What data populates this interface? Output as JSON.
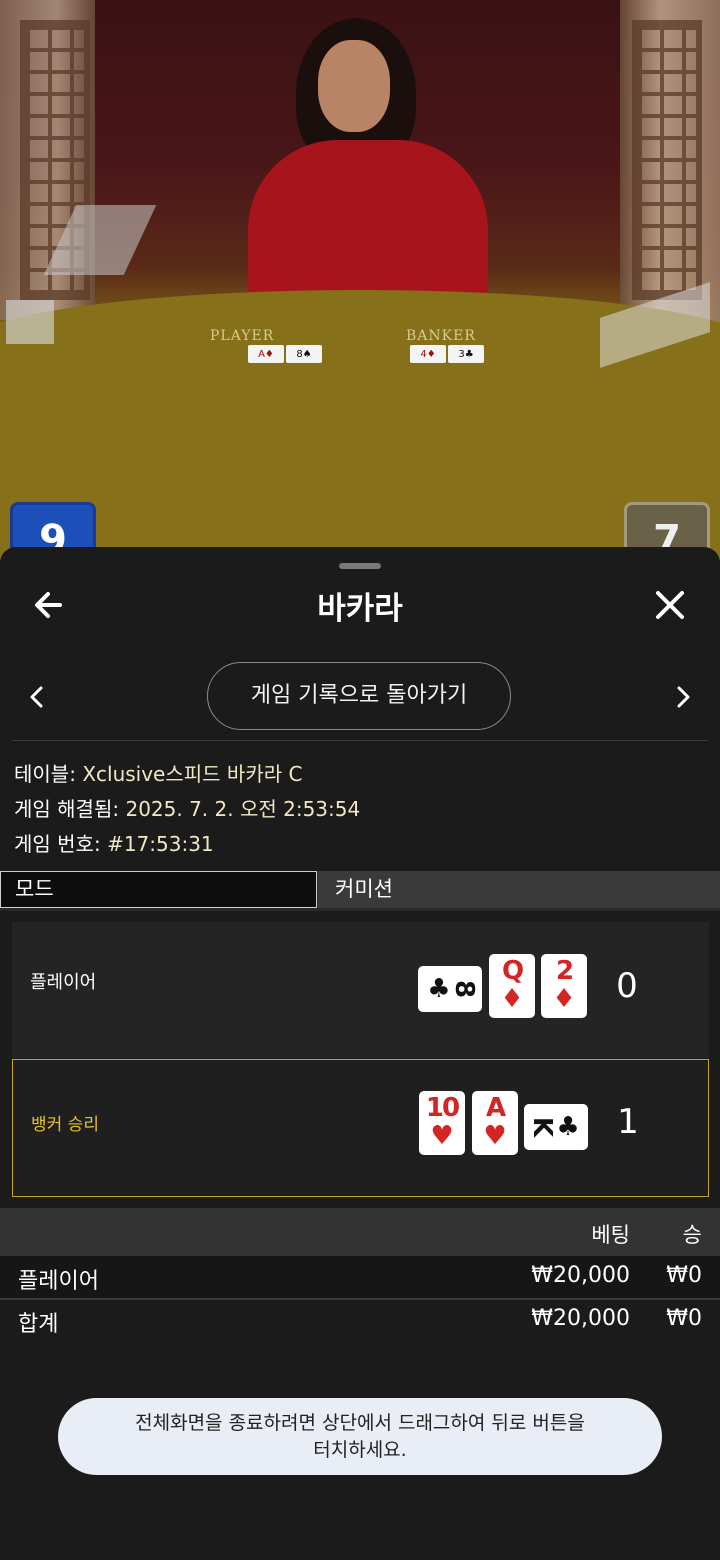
{
  "video": {
    "table_labels": {
      "player": "PLAYER",
      "banker": "BANKER"
    },
    "player_score": "9",
    "banker_score": "7"
  },
  "header": {
    "back_icon": "arrow-left-icon",
    "title": "바카라",
    "close_icon": "close-icon"
  },
  "nav": {
    "prev_icon": "chevron-left-icon",
    "next_icon": "chevron-right-icon",
    "back_to_history_label": "게임 기록으로 돌아가기"
  },
  "info": {
    "table_label": "테이블:",
    "table_value": "Xclusive스피드 바카라 C",
    "resolved_label": "게임 해결됨:",
    "resolved_value": "2025. 7. 2. 오전 2:53:54",
    "number_label": "게임 번호:",
    "number_value": "#17:53:31"
  },
  "tabs": {
    "mode": "모드",
    "commission": "커미션"
  },
  "results": {
    "player": {
      "label": "플레이어",
      "score": "0",
      "cards": [
        {
          "rank": "8",
          "suit": "♣",
          "color": "#111111",
          "orientation": "sideways"
        },
        {
          "rank": "Q",
          "suit": "♦",
          "color": "#d42424",
          "orientation": "upright"
        },
        {
          "rank": "2",
          "suit": "♦",
          "color": "#d42424",
          "orientation": "upright"
        }
      ]
    },
    "banker": {
      "label": "뱅커 승리",
      "label_color": "#e6c02a",
      "score": "1",
      "cards": [
        {
          "rank": "10",
          "suit": "♥",
          "color": "#d42424",
          "orientation": "upright"
        },
        {
          "rank": "A",
          "suit": "♥",
          "color": "#d42424",
          "orientation": "upright"
        },
        {
          "rank": "K",
          "suit": "♣",
          "color": "#111111",
          "orientation": "sideways"
        }
      ]
    }
  },
  "bets": {
    "headers": {
      "bet": "베팅",
      "win": "승"
    },
    "rows": [
      {
        "name": "플레이어",
        "bet": "₩20,000",
        "win": "₩0"
      }
    ],
    "total": {
      "name": "합계",
      "bet": "₩20,000",
      "win": "₩0"
    }
  },
  "toast": {
    "line1": "전체화면을 종료하려면 상단에서 드래그하여 뒤로 버튼을",
    "line2": "터치하세요."
  }
}
